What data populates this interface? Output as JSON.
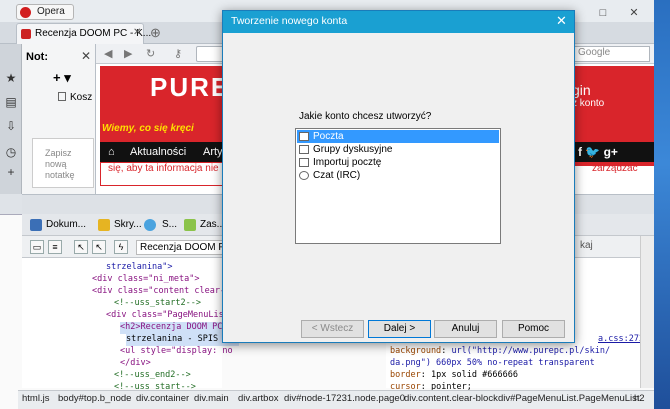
{
  "browser": {
    "app_button": "Opera",
    "tab_title": "Recenzja DOOM PC - K...",
    "search_placeholder": "Google"
  },
  "notes_panel": {
    "title": "Not:",
    "trash": "Kosz",
    "editor_placeholder": "Zapisz nową notatkę"
  },
  "webpage": {
    "logo_text": "PURE PC",
    "slogan": "Wiemy, co się kręci",
    "menu": [
      "Aktualności",
      "Arty"
    ],
    "notice": "się, aby ta informacja nie",
    "login": "gin",
    "konto": "ż konto",
    "social": "f  🐦  g+",
    "manage": "zarządzać"
  },
  "devtools": {
    "tabs": [
      "Dokum...",
      "Skry...",
      "S...",
      "Zas..."
    ],
    "breadcrumb_top": "Recenzja DOOM PC - K",
    "right_pane_label": "kaj",
    "dom_lines": [
      "strzelanina\">",
      "<div class=\"ni_meta\">",
      "<div class=\"content clear-b",
      "<!--uss_start2-->",
      "<div class=\"PageMenuList",
      "<h2>Recenzja DOOM PC -",
      "strzelanina - SPIS TRE",
      "<ul style=\"display: no",
      "</div>",
      "<!--uss_end2-->",
      "<!--uss_start-->",
      "<!--uss_end-->"
    ],
    "styles_lines": [
      {
        "prop": "",
        "value": "",
        "link": "a.css:272"
      },
      {
        "prop": "background",
        "value": "url(\"http://www.purepc.pl/skin/"
      },
      {
        "prop": "",
        "value": "da.png\") 660px 50% no-repeat transparent"
      },
      {
        "prop": "border",
        "value": "1px solid #666666"
      },
      {
        "prop": "cursor",
        "value": "pointer;"
      }
    ],
    "bottom_crumbs": [
      "html.js",
      "body#top.b_node",
      "div.container",
      "div.main",
      "div.artbox",
      "div#node-17231.node.page0",
      "div.content.clear-block",
      "div#PageMenuList.PageMenuList",
      "h2"
    ]
  },
  "dialog": {
    "title": "Tworzenie nowego konta",
    "question": "Jakie konto chcesz utworzyć?",
    "options": [
      "Poczta",
      "Grupy dyskusyjne",
      "Importuj pocztę",
      "Czat (IRC)"
    ],
    "selected_index": 0,
    "buttons": {
      "back": "< Wstecz",
      "next": "Dalej >",
      "cancel": "Anuluj",
      "help": "Pomoc"
    }
  }
}
